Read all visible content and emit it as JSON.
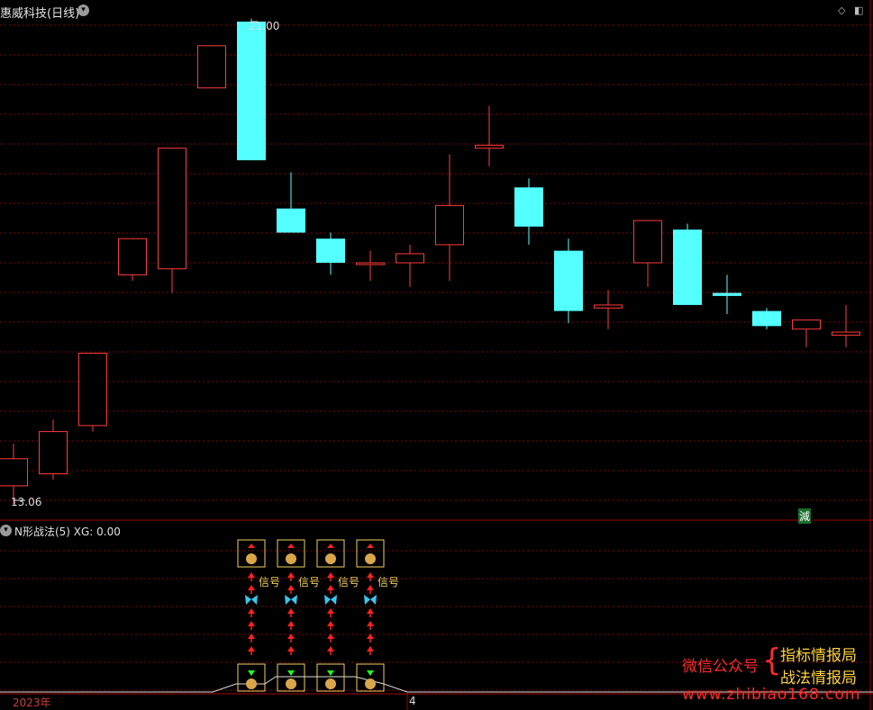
{
  "header": {
    "title": "惠威科技(日线)",
    "high_label": "21.00",
    "low_label": "13.06",
    "reduce_badge": "減"
  },
  "indicator": {
    "title": "N形战法(5)  XG: 0.00",
    "signal_label": "信号"
  },
  "axis": {
    "year_label": "2023年",
    "month_label": "4"
  },
  "watermark": {
    "account_label": "微信公众号",
    "name1": "指标情报局",
    "name2": "战法情报局",
    "site": "www.zhibiao168.com"
  },
  "colors": {
    "up": "#ff3b3b",
    "down": "#54ffff",
    "grid": "#8a0000",
    "signal": "#f0d060"
  },
  "chart_data": {
    "type": "candlestick",
    "ylim": [
      13.06,
      21.0
    ],
    "candles": [
      {
        "o": 13.3,
        "h": 14.0,
        "l": 13.0,
        "c": 13.75
      },
      {
        "o": 13.5,
        "h": 14.4,
        "l": 13.4,
        "c": 14.2
      },
      {
        "o": 14.3,
        "h": 15.5,
        "l": 14.2,
        "c": 15.5
      },
      {
        "o": 16.8,
        "h": 17.4,
        "l": 16.7,
        "c": 17.4
      },
      {
        "o": 16.9,
        "h": 18.9,
        "l": 16.5,
        "c": 18.9
      },
      {
        "o": 19.9,
        "h": 20.5,
        "l": 19.9,
        "c": 20.6
      },
      {
        "o": 21.0,
        "h": 21.05,
        "l": 18.7,
        "c": 18.7
      },
      {
        "o": 17.9,
        "h": 18.5,
        "l": 17.9,
        "c": 17.5
      },
      {
        "o": 17.4,
        "h": 17.5,
        "l": 16.8,
        "c": 17.0
      },
      {
        "o": 17.0,
        "h": 17.2,
        "l": 16.7,
        "c": 17.0
      },
      {
        "o": 17.0,
        "h": 17.3,
        "l": 16.6,
        "c": 17.15
      },
      {
        "o": 17.3,
        "h": 18.8,
        "l": 16.7,
        "c": 17.95
      },
      {
        "o": 18.9,
        "h": 19.6,
        "l": 18.6,
        "c": 18.95
      },
      {
        "o": 18.25,
        "h": 18.4,
        "l": 17.3,
        "c": 17.6
      },
      {
        "o": 17.2,
        "h": 17.4,
        "l": 16.0,
        "c": 16.2
      },
      {
        "o": 16.25,
        "h": 16.55,
        "l": 15.9,
        "c": 16.3
      },
      {
        "o": 17.0,
        "h": 17.7,
        "l": 16.6,
        "c": 17.7
      },
      {
        "o": 17.55,
        "h": 17.65,
        "l": 16.4,
        "c": 16.3
      },
      {
        "o": 16.5,
        "h": 16.8,
        "l": 16.15,
        "c": 16.45
      },
      {
        "o": 16.2,
        "h": 16.25,
        "l": 15.9,
        "c": 15.95
      },
      {
        "o": 15.9,
        "h": 16.0,
        "l": 15.6,
        "c": 16.05
      },
      {
        "o": 15.8,
        "h": 16.3,
        "l": 15.6,
        "c": 15.85
      }
    ],
    "signals": [
      {
        "candle": 6,
        "label": "信号"
      },
      {
        "candle": 7,
        "label": "信号"
      },
      {
        "candle": 8,
        "label": "信号"
      },
      {
        "candle": 9,
        "label": "信号"
      }
    ]
  }
}
